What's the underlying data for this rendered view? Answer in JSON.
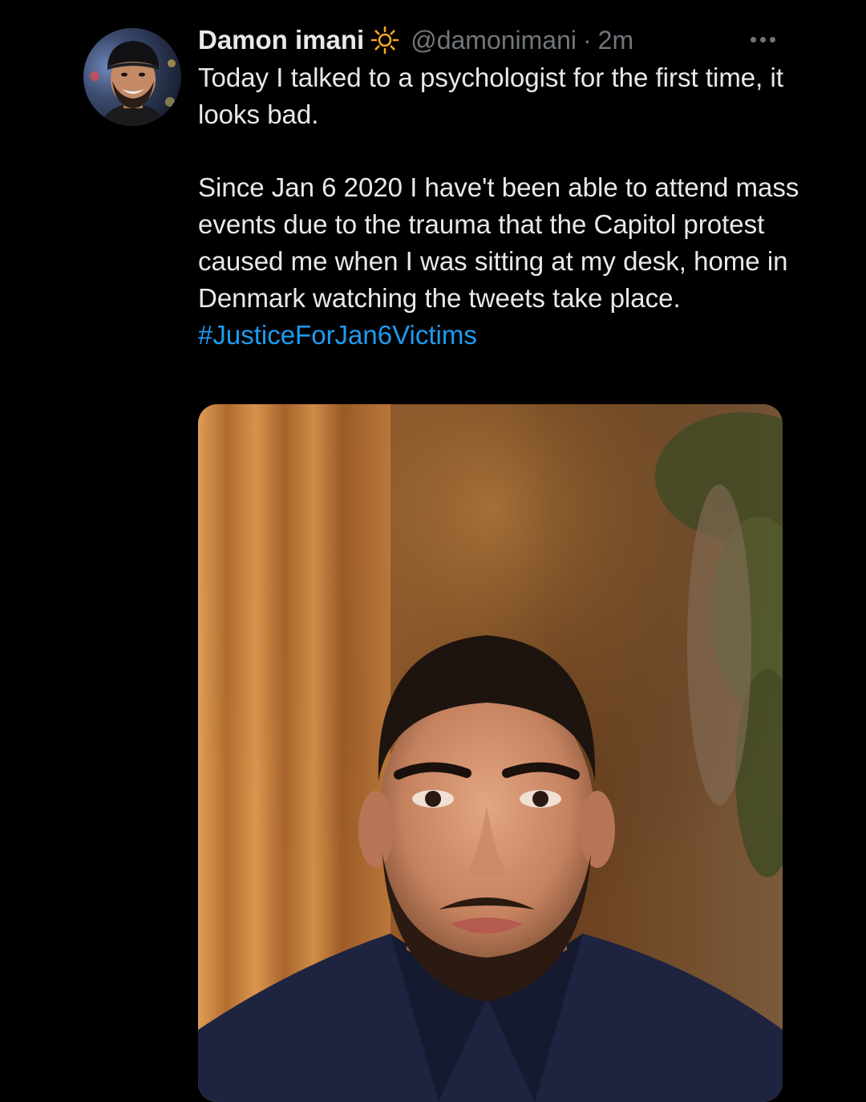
{
  "tweet": {
    "display_name": "Damon imani",
    "badge_icon": "sun-icon",
    "handle": "@damonimani",
    "separator": "·",
    "time": "2m",
    "more_icon": "more-horizontal-icon",
    "text_paragraph_1": "Today I talked to a psychologist for the first time, it looks bad.",
    "text_paragraph_2": "Since Jan 6 2020 I have't been able to attend mass events due to the trauma that the Capitol protest caused me when I was sitting at my desk, home in Denmark watching the tweets take place.",
    "hashtag": "#JusticeForJan6Victims",
    "media_description": "selfie-photo"
  },
  "colors": {
    "background": "#000000",
    "text_primary": "#e7e9ea",
    "text_secondary": "#71767b",
    "link": "#1d9bf0",
    "badge": "#f5a623"
  }
}
